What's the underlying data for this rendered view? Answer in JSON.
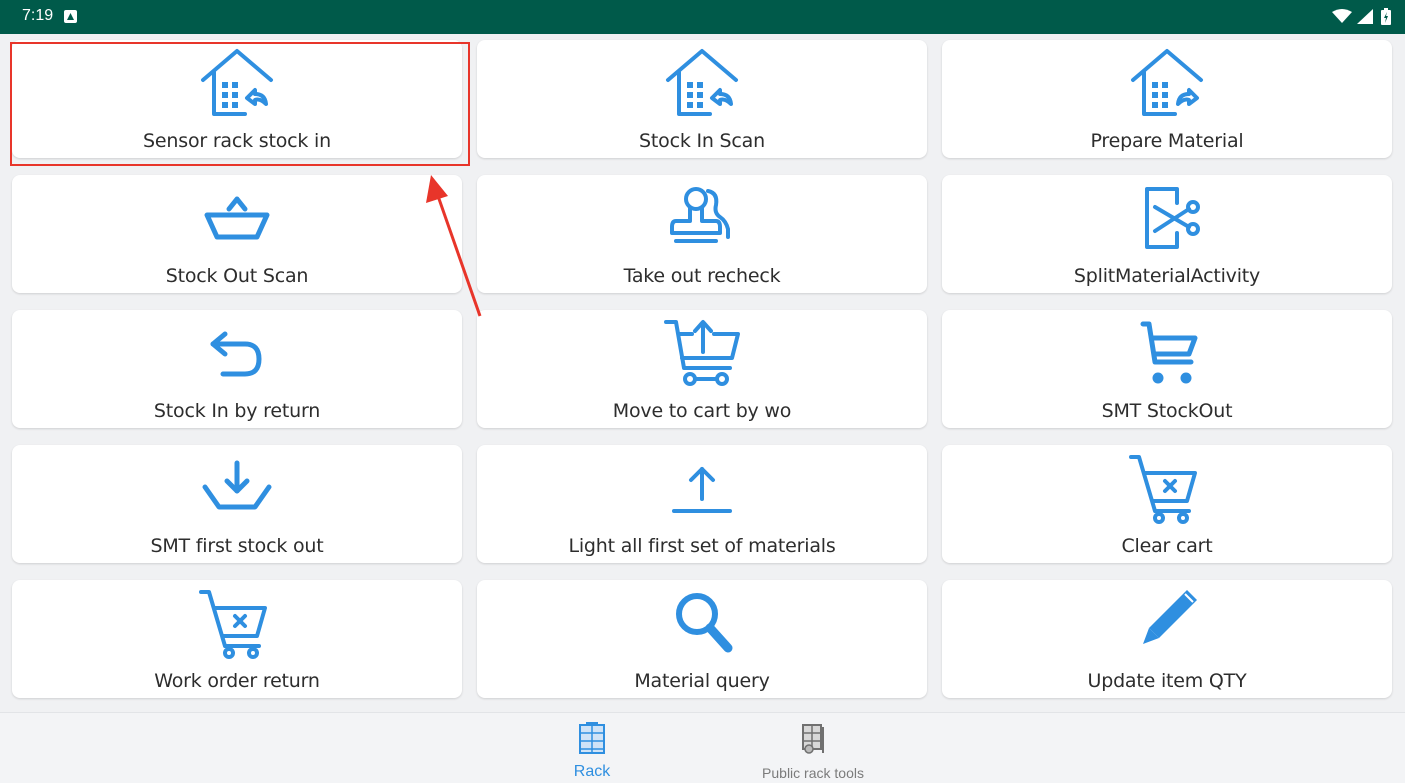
{
  "status_bar": {
    "time": "7:19",
    "icons": [
      "notification-icon",
      "wifi-icon",
      "signal-icon",
      "battery-icon"
    ]
  },
  "tiles": [
    {
      "label": "Sensor rack stock in",
      "icon": "warehouse-return-icon"
    },
    {
      "label": "Stock In Scan",
      "icon": "warehouse-return-icon"
    },
    {
      "label": "Prepare Material",
      "icon": "warehouse-forward-icon"
    },
    {
      "label": "Stock Out Scan",
      "icon": "basket-icon"
    },
    {
      "label": "Take out recheck",
      "icon": "stamp-icon"
    },
    {
      "label": "SplitMaterialActivity",
      "icon": "scissors-door-icon"
    },
    {
      "label": "Stock In by return",
      "icon": "undo-arrow-icon"
    },
    {
      "label": "Move to cart by wo",
      "icon": "cart-upload-icon"
    },
    {
      "label": "SMT StockOut",
      "icon": "cart-icon"
    },
    {
      "label": "SMT first stock out",
      "icon": "tray-download-icon"
    },
    {
      "label": "Light all first set of materials",
      "icon": "upload-arrow-icon"
    },
    {
      "label": "Clear cart",
      "icon": "cart-clear-icon"
    },
    {
      "label": "Work order return",
      "icon": "cart-clear-icon"
    },
    {
      "label": "Material query",
      "icon": "search-icon"
    },
    {
      "label": "Update item QTY",
      "icon": "pencil-icon"
    }
  ],
  "bottom_nav": {
    "items": [
      {
        "label": "Rack",
        "icon": "rack-icon",
        "active": true
      },
      {
        "label": "Public rack tools",
        "icon": "rack-tools-icon",
        "active": false
      }
    ]
  },
  "colors": {
    "status_bar": "#005a4a",
    "icon_blue": "#2f8fe0",
    "annotation_red": "#e8352a",
    "background": "#f0f1f3"
  }
}
